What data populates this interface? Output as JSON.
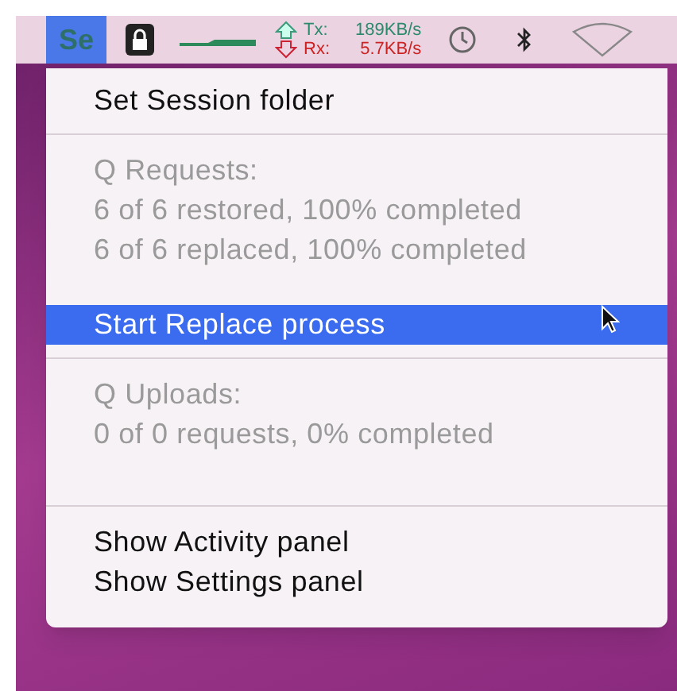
{
  "menubar": {
    "items": [
      {
        "kind": "app",
        "label": "Se",
        "selected": true
      },
      {
        "kind": "lock",
        "selected": false
      },
      {
        "kind": "graph",
        "selected": false
      },
      {
        "kind": "traffic",
        "tx_label": "Tx:",
        "tx_value": "189KB/s",
        "rx_label": "Rx:",
        "rx_value": "5.7KB/s",
        "selected": false
      },
      {
        "kind": "clock",
        "selected": false
      },
      {
        "kind": "bluetooth",
        "selected": false
      },
      {
        "kind": "wifi",
        "selected": false
      }
    ]
  },
  "menu": {
    "sections": [
      {
        "items": [
          {
            "label": "Set Session folder",
            "disabled": false,
            "selected": false
          }
        ]
      },
      {
        "items": [
          {
            "label": "Q Requests:",
            "disabled": true,
            "selected": false
          },
          {
            "label": "6 of 6 restored, 100% completed",
            "disabled": true,
            "selected": false
          },
          {
            "label": "6 of 6 replaced, 100% completed",
            "disabled": true,
            "selected": false
          },
          {
            "label": "Start Replace process",
            "disabled": false,
            "selected": true,
            "gap": true
          }
        ]
      },
      {
        "items": [
          {
            "label": "Q Uploads:",
            "disabled": true,
            "selected": false
          },
          {
            "label": "0 of 0 requests, 0% completed",
            "disabled": true,
            "selected": false
          }
        ],
        "trailing_space": true
      },
      {
        "items": [
          {
            "label": "Show Activity panel",
            "disabled": false,
            "selected": false
          },
          {
            "label": "Show Settings panel",
            "disabled": false,
            "selected": false
          }
        ]
      }
    ]
  }
}
